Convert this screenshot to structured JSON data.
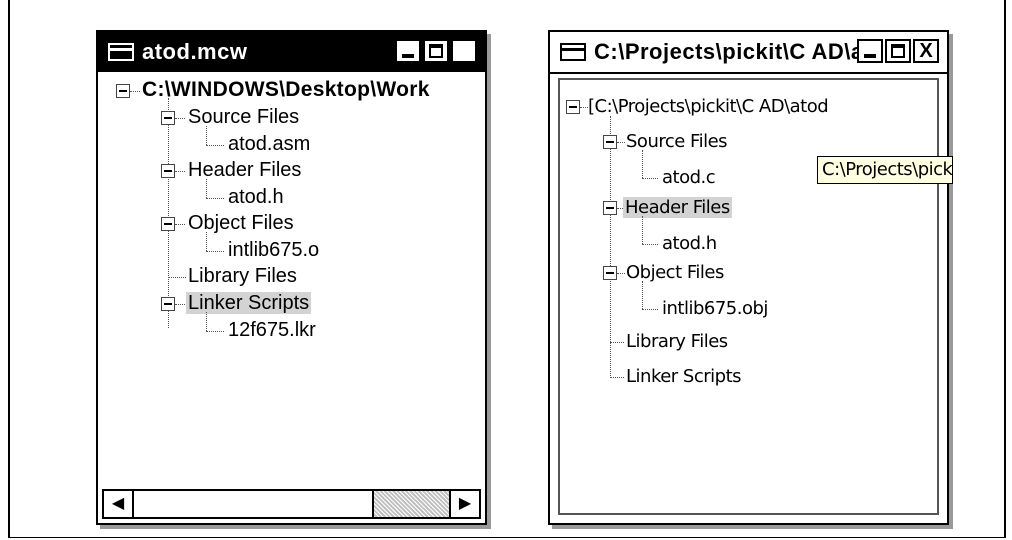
{
  "window1": {
    "title": "atod.mcw",
    "controls": {
      "minimize": "_",
      "maximize": "□",
      "close": "X"
    },
    "root": "C:\\WINDOWS\\Desktop\\Work",
    "items": [
      {
        "label": "Source Files"
      },
      {
        "label": "atod.asm"
      },
      {
        "label": "Header Files"
      },
      {
        "label": "atod.h"
      },
      {
        "label": "Object Files"
      },
      {
        "label": "intlib675.o"
      },
      {
        "label": "Library Files"
      },
      {
        "label": "Linker Scripts",
        "selected": true
      },
      {
        "label": "12f675.lkr"
      }
    ],
    "scrollbar": {
      "left_arrow": "◀",
      "right_arrow": "▶"
    }
  },
  "window2": {
    "title": "C:\\Projects\\pickit\\C AD\\a...",
    "controls": {
      "minimize": "_",
      "maximize": "□",
      "close": "X"
    },
    "root": "[C:\\Projects\\pickit\\C AD\\atod",
    "tooltip": "C:\\Projects\\pickit",
    "items": [
      {
        "label": "Source Files"
      },
      {
        "label": "atod.c"
      },
      {
        "label": "Header Files",
        "selected": true
      },
      {
        "label": "atod.h"
      },
      {
        "label": "Object Files"
      },
      {
        "label": "intlib675.obj"
      },
      {
        "label": "Library Files"
      },
      {
        "label": "Linker Scripts"
      }
    ]
  },
  "colors": {
    "highlight": "#d3d3d3",
    "tooltip_bg": "#ffffe1",
    "titlebar_active": "#000000"
  }
}
